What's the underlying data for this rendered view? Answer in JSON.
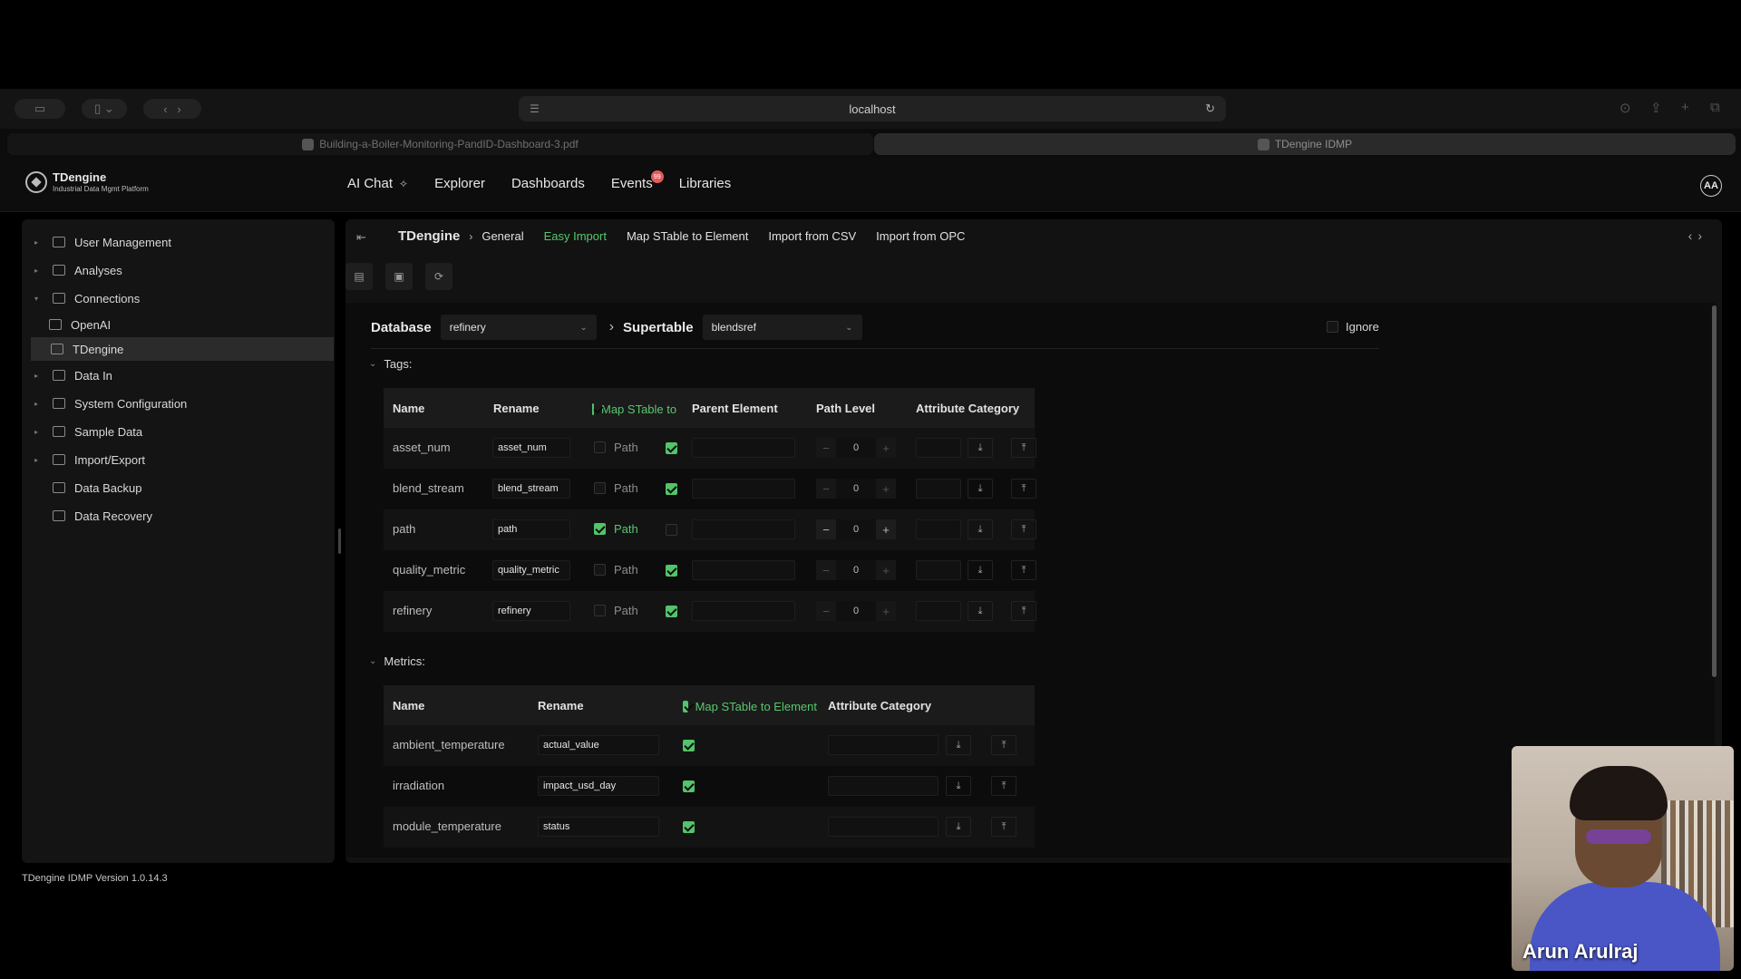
{
  "browser": {
    "url": "localhost",
    "tabs": [
      {
        "title": "Building-a-Boiler-Monitoring-PandID-Dashboard-3.pdf"
      },
      {
        "title": "TDengine IDMP"
      }
    ]
  },
  "app": {
    "logo_title": "TDengine",
    "logo_subtitle": "Industrial Data Mgmt Platform",
    "nav": [
      {
        "label": "AI Chat",
        "icon": "sparkle-icon"
      },
      {
        "label": "Explorer"
      },
      {
        "label": "Dashboards"
      },
      {
        "label": "Events",
        "badge": "99"
      },
      {
        "label": "Libraries"
      }
    ],
    "avatar": "AA",
    "version": "TDengine IDMP Version 1.0.14.3"
  },
  "sidebar": {
    "items": [
      {
        "label": "User Management",
        "icon": "user-icon"
      },
      {
        "label": "Analyses",
        "icon": "chart-icon"
      },
      {
        "label": "Connections",
        "icon": "connection-icon",
        "expanded": true
      },
      {
        "label": "OpenAI",
        "icon": "openai-icon",
        "child": true
      },
      {
        "label": "TDengine",
        "icon": "database-icon",
        "child": true,
        "active": true
      },
      {
        "label": "Data In",
        "icon": "data-in-icon"
      },
      {
        "label": "System Configuration",
        "icon": "config-icon"
      },
      {
        "label": "Sample Data",
        "icon": "sample-icon"
      },
      {
        "label": "Import/Export",
        "icon": "import-export-icon"
      },
      {
        "label": "Data Backup",
        "icon": "backup-icon"
      },
      {
        "label": "Data Recovery",
        "icon": "recovery-icon"
      }
    ]
  },
  "breadcrumb": {
    "home": "TDengine",
    "tabs": [
      "General",
      "Easy Import",
      "Map STable to Element",
      "Import from CSV",
      "Import from OPC"
    ],
    "active_tab": "Easy Import"
  },
  "import": {
    "database_label": "Database",
    "database_value": "refinery",
    "supertable_label": "Supertable",
    "supertable_value": "blendsref",
    "ignore_label": "Ignore",
    "tags_title": "Tags:",
    "tags_headers": [
      "Name",
      "Rename",
      "Map STable to Element",
      "Parent Element",
      "Path Level",
      "Attribute Category"
    ],
    "tags": [
      {
        "name": "asset_num",
        "rename": "asset_num",
        "path_checked": false,
        "path_label": "Path",
        "map_checked": true,
        "level": "0"
      },
      {
        "name": "blend_stream",
        "rename": "blend_stream",
        "path_checked": false,
        "path_label": "Path",
        "map_checked": true,
        "level": "0"
      },
      {
        "name": "path",
        "rename": "path",
        "path_checked": true,
        "path_label": "Path",
        "map_checked": false,
        "level": "0"
      },
      {
        "name": "quality_metric",
        "rename": "quality_metric",
        "path_checked": false,
        "path_label": "Path",
        "map_checked": true,
        "level": "0"
      },
      {
        "name": "refinery",
        "rename": "refinery",
        "path_checked": false,
        "path_label": "Path",
        "map_checked": true,
        "level": "0"
      }
    ],
    "metrics_title": "Metrics:",
    "metrics_headers": [
      "Name",
      "Rename",
      "Map STable to Element",
      "Attribute Category"
    ],
    "metrics": [
      {
        "name": "ambient_temperature",
        "rename": "actual_value",
        "checked": true
      },
      {
        "name": "irradiation",
        "rename": "impact_usd_day",
        "checked": true
      },
      {
        "name": "module_temperature",
        "rename": "status",
        "checked": true
      }
    ]
  },
  "webcam": {
    "name": "Arun Arulraj"
  }
}
